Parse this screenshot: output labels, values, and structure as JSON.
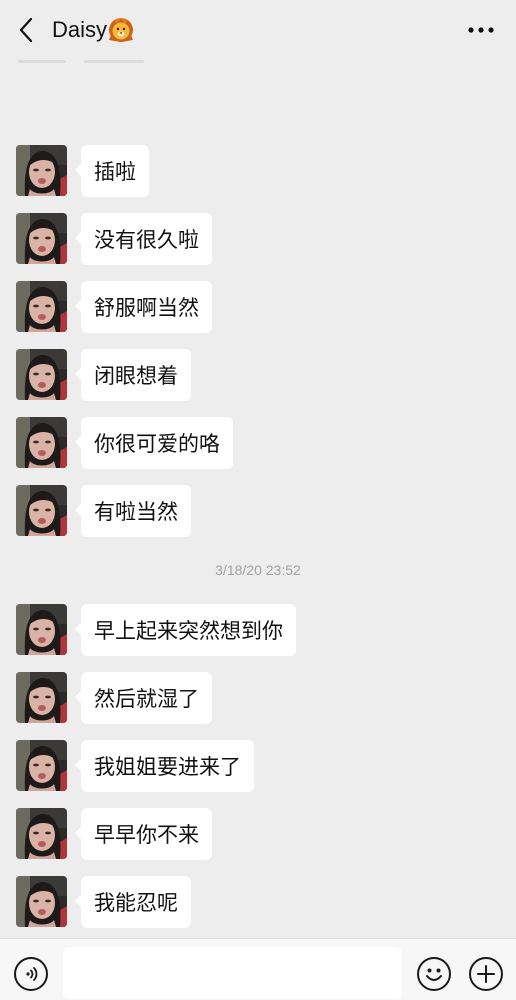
{
  "header": {
    "contact_name": "Daisy",
    "name_emoji_icon": "lion-face-icon",
    "back_icon": "chevron-left-icon",
    "more_icon": "ellipsis-icon"
  },
  "messages_before": [
    {
      "text": "插啦",
      "sender": "contact"
    },
    {
      "text": "没有很久啦",
      "sender": "contact"
    },
    {
      "text": "舒服啊当然",
      "sender": "contact"
    },
    {
      "text": "闭眼想着",
      "sender": "contact"
    },
    {
      "text": "你很可爱的咯",
      "sender": "contact"
    },
    {
      "text": "有啦当然",
      "sender": "contact"
    }
  ],
  "timestamp": "3/18/20 23:52",
  "messages_after": [
    {
      "text": "早上起来突然想到你",
      "sender": "contact"
    },
    {
      "text": "然后就湿了",
      "sender": "contact"
    },
    {
      "text": "我姐姐要进来了",
      "sender": "contact"
    },
    {
      "text": "早早你不来",
      "sender": "contact"
    },
    {
      "text": "我能忍呢",
      "sender": "contact"
    }
  ],
  "input_bar": {
    "value": "",
    "voice_icon": "voice-icon",
    "emoji_icon": "smiley-icon",
    "plus_icon": "plus-icon"
  },
  "colors": {
    "background": "#ededed",
    "bubble": "#ffffff",
    "timestamp_text": "#a3a3a3"
  }
}
